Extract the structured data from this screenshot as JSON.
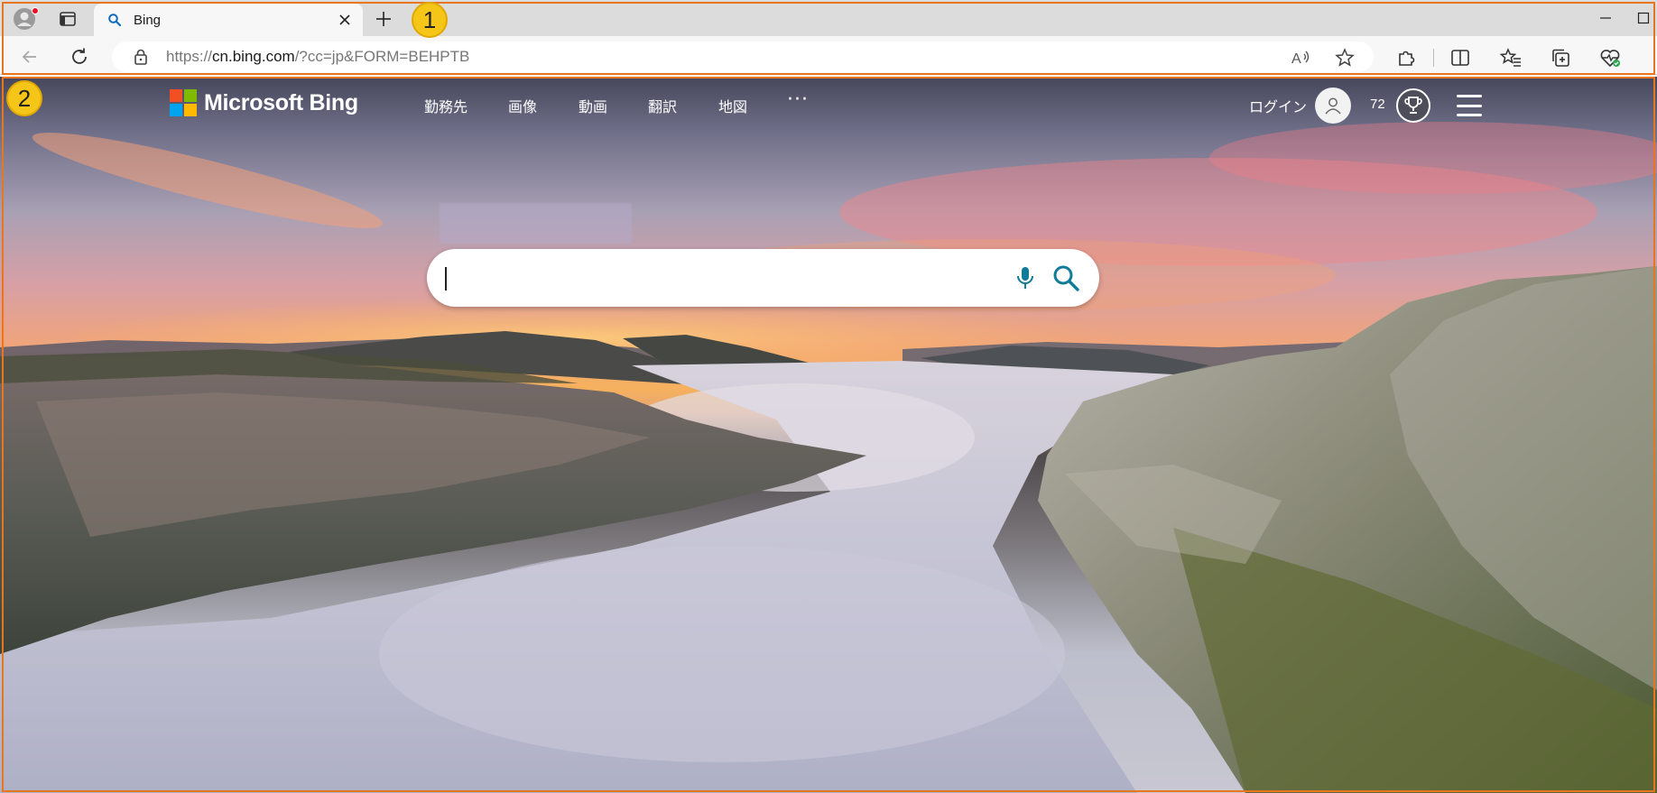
{
  "browser": {
    "tab": {
      "title": "Bing"
    },
    "url": {
      "prefix": "https://",
      "host": "cn.bing.com",
      "path": "/?cc=jp&FORM=BEHPTB"
    },
    "markers": [
      "1",
      "2"
    ]
  },
  "bing": {
    "logo_text": "Microsoft Bing",
    "nav": [
      "勤務先",
      "画像",
      "動画",
      "翻訳",
      "地図"
    ],
    "more": "···",
    "login": "ログイン",
    "points": "72",
    "search_value": ""
  },
  "colors": {
    "accent": "#e8761e",
    "marker": "#f5c518",
    "bing_blue": "#0f6cbd",
    "search_icon": "#107c9a"
  },
  "icons": [
    "profile-icon",
    "tab-actions-icon",
    "search-favicon-icon",
    "close-icon",
    "plus-icon",
    "minimize-icon",
    "restore-icon",
    "back-icon",
    "refresh-icon",
    "lock-icon",
    "read-aloud-icon",
    "favorite-add-icon",
    "extensions-icon",
    "split-screen-icon",
    "favorites-icon",
    "collections-icon",
    "browser-essentials-icon",
    "user-icon",
    "trophy-icon",
    "hamburger-icon",
    "microphone-icon",
    "search-icon"
  ]
}
